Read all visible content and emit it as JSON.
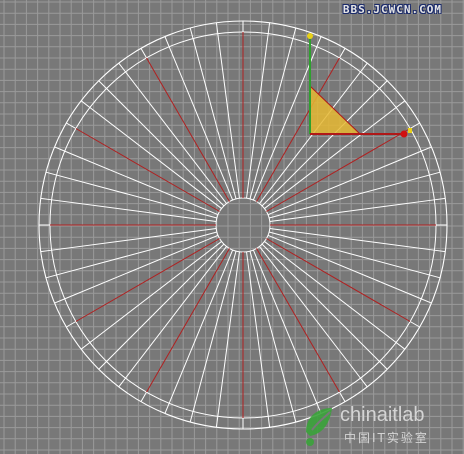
{
  "viewport": {
    "background": "#787878",
    "grid_color": "#9a9a9a",
    "grid_major_color": "#8c8c8c",
    "wire_color": "#ffffff",
    "accent_wire_color": "#b02020",
    "spoke_count": 48,
    "accent_spoke_every": 4
  },
  "gizmo": {
    "x_axis_color": "#b01818",
    "y_axis_color": "#2ea02e",
    "plane_fill": "#e6b832",
    "axis_tip_color": "#e8d018",
    "pivot_color": "#d01010"
  },
  "watermark_top": {
    "text": "BBS.JCWCN.COM"
  },
  "watermark_bottom": {
    "brand": "chinaitlab",
    "subtitle": "中国IT实验室",
    "logo_color": "#3aa33a"
  }
}
